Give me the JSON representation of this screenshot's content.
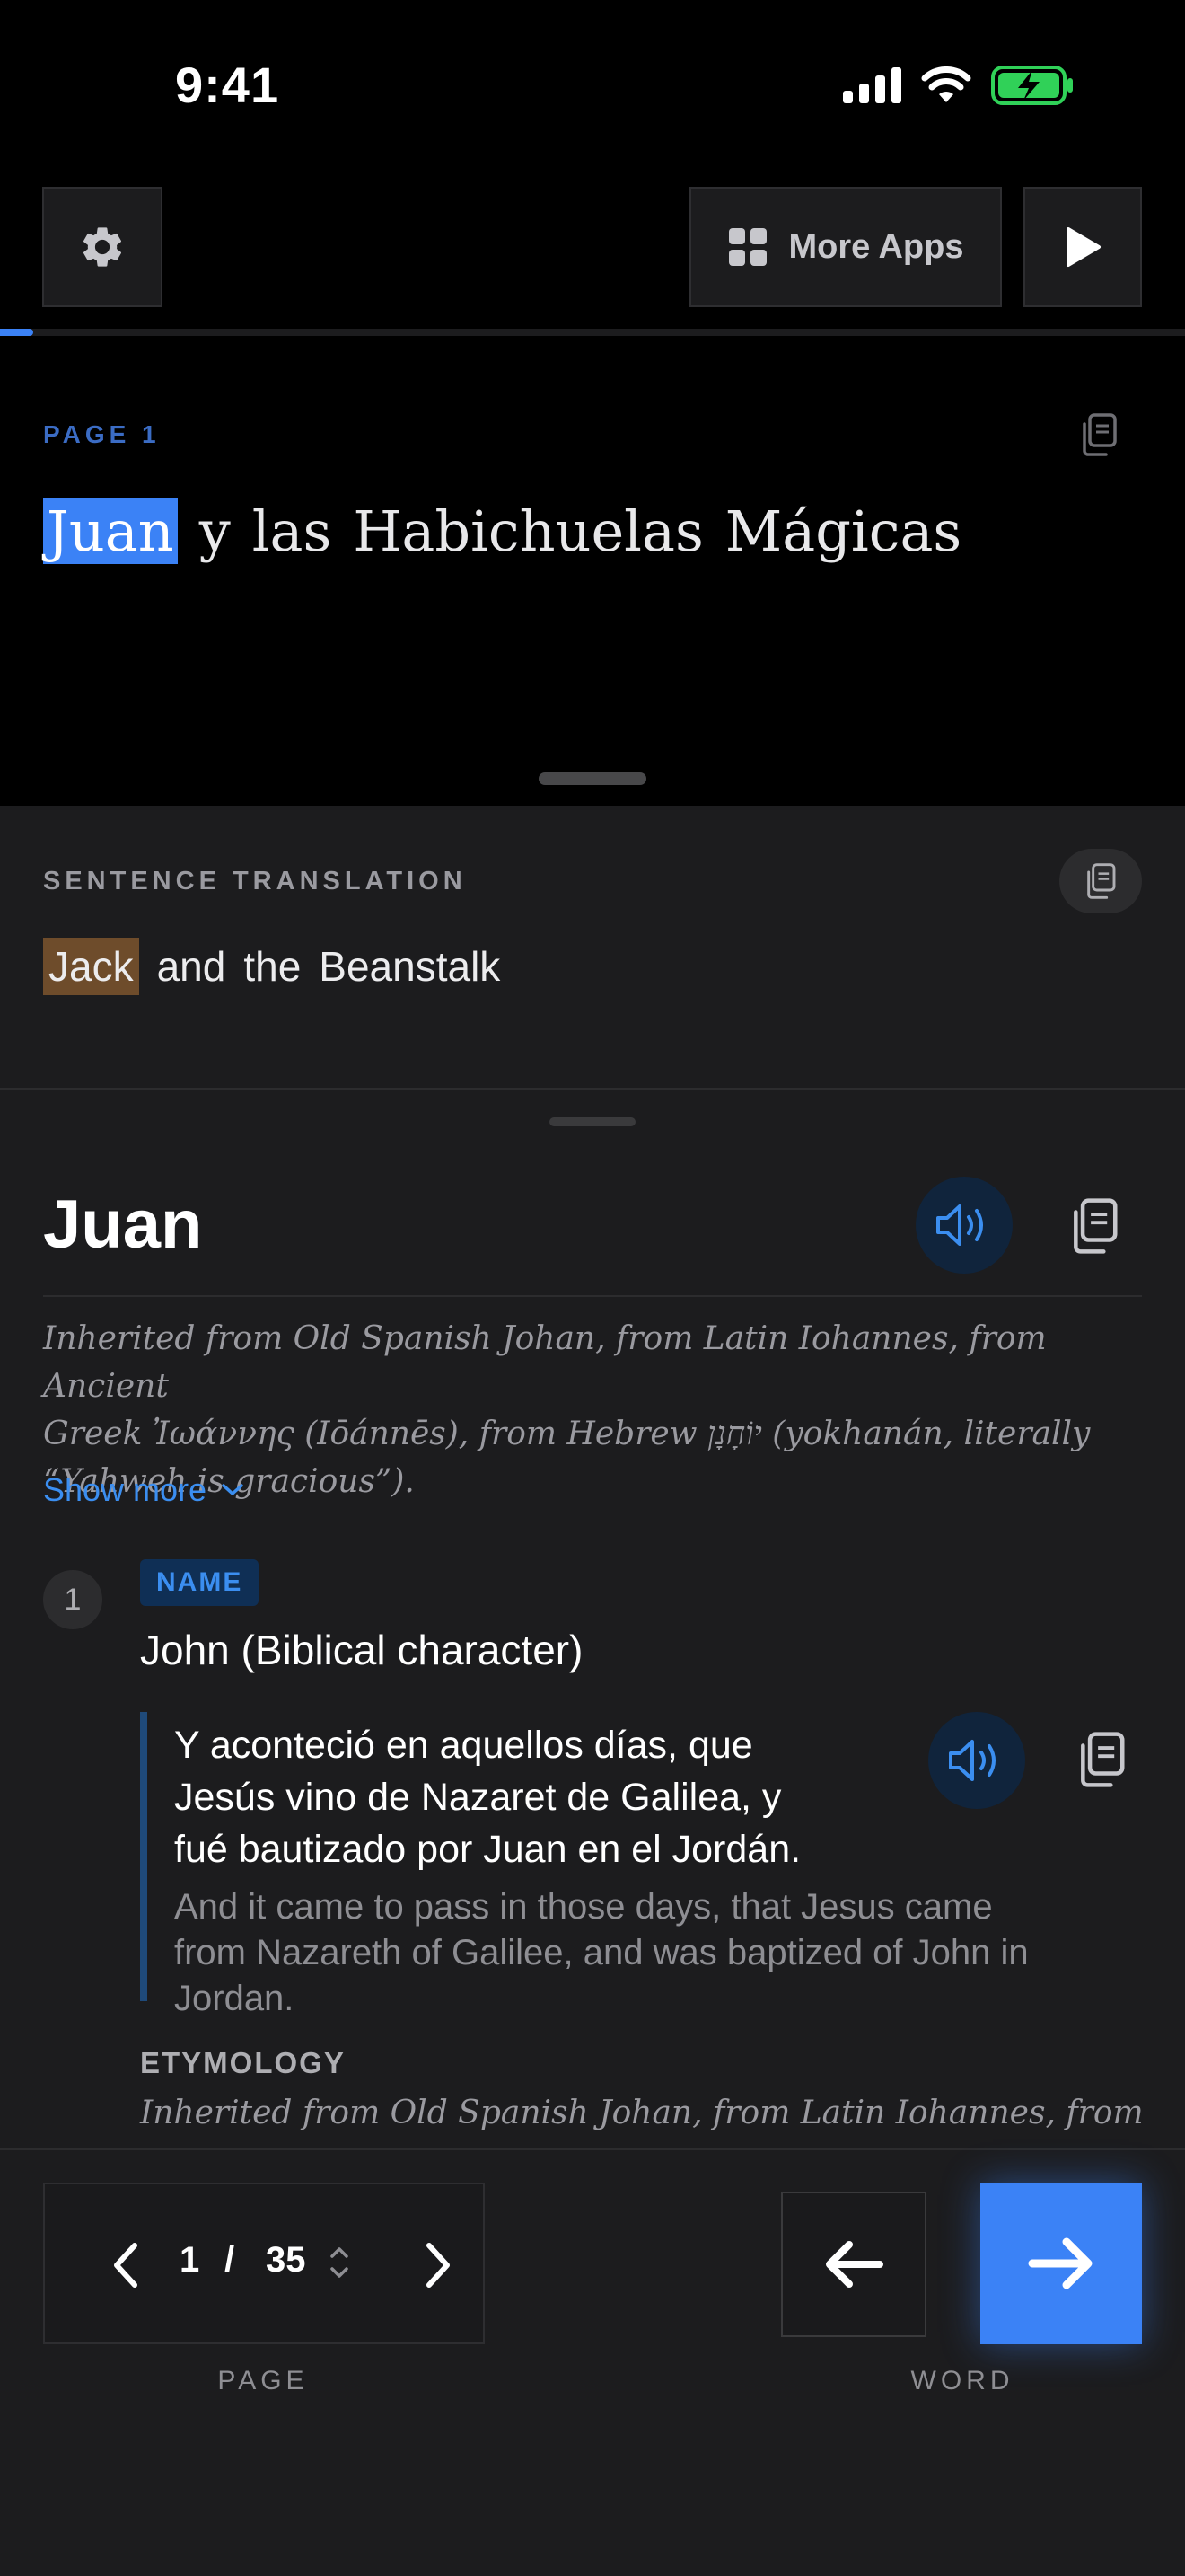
{
  "status_bar": {
    "time": "9:41"
  },
  "toolbar": {
    "more_apps_label": "More Apps",
    "progress_fraction": 0.028
  },
  "reader": {
    "page_label": "PAGE 1",
    "sentence_words": [
      "Juan",
      "y",
      "las",
      "Habichuelas",
      "Mágicas"
    ],
    "highlighted_index": 0
  },
  "translation": {
    "label": "SENTENCE TRANSLATION",
    "words": [
      "Jack",
      "and",
      "the",
      "Beanstalk"
    ],
    "highlighted_index": 0
  },
  "dictionary": {
    "headword": "Juan",
    "etymology_line1": "Inherited from Old Spanish Johan, from Latin Iohannes, from Ancient",
    "etymology_line2": "Greek Ἰωάννης (Iōánnēs), from Hebrew יוֹחָנָן (yokhanán, literally",
    "etymology_line3": "“Yahweh is gracious”).",
    "show_more": "Show more",
    "senses": [
      {
        "number": "1",
        "pos": "NAME",
        "gloss": "John (Biblical character)",
        "example_es_line1": "Y aconteció en aquellos días, que",
        "example_es_line2": "Jesús vino de Nazaret de Galilea, y",
        "example_es_line3": "fué bautizado por Juan en el Jordán.",
        "example_en_line1": "And it came to pass in those days, that Jesus came",
        "example_en_line2": "from Nazareth of Galilee, and was baptized of John in",
        "example_en_line3": "Jordan.",
        "etymology_label": "ETYMOLOGY",
        "etymology": "Inherited from Old Spanish Johan, from Latin Iohannes, from"
      }
    ]
  },
  "bottom_nav": {
    "current_page": "1",
    "separator": "/",
    "total_pages": "35",
    "page_caption": "PAGE",
    "word_caption": "WORD"
  },
  "colors": {
    "accent": "#3b82f6",
    "link": "#3b8ef0",
    "translation_highlight": "#6e4c2b",
    "battery": "#30d158"
  }
}
